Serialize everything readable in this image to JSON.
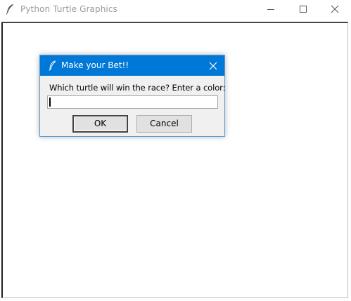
{
  "window": {
    "title": "Python Turtle Graphics",
    "app_icon": "feather-icon",
    "controls": [
      "minimize-icon",
      "maximize-icon",
      "close-icon"
    ]
  },
  "dialog": {
    "title": "Make your Bet!!",
    "icon": "feather-icon",
    "prompt": "Which turtle will win the race? Enter a  color:",
    "input_value": "",
    "ok_label": "OK",
    "cancel_label": "Cancel",
    "accent_color": "#0078d7"
  }
}
